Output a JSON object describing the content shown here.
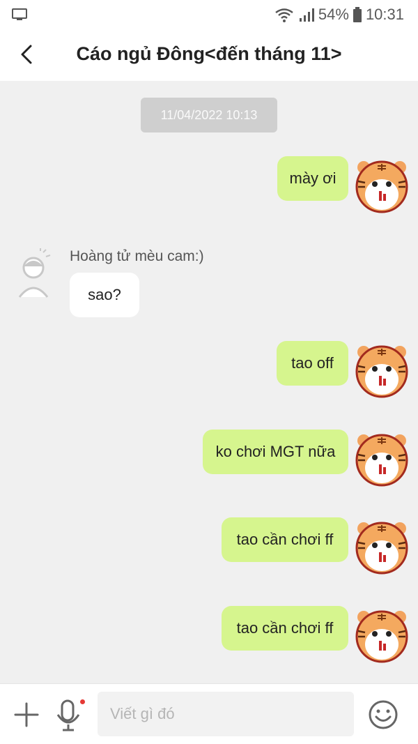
{
  "status_bar": {
    "icons": [
      "screen-icon",
      "wifi-icon",
      "signal-icon",
      "battery-icon"
    ],
    "battery": "54%",
    "time": "10:31"
  },
  "header": {
    "back_icon": "chevron-left-icon",
    "title": "Cáo ngủ Đông<đến tháng 11>"
  },
  "chat": {
    "date_stamp": "11/04/2022 10:13",
    "incoming_sender": "Hoàng tử mèu cam:)",
    "messages": [
      {
        "direction": "out",
        "text": "mày ơi"
      },
      {
        "direction": "in",
        "text": "sao?"
      },
      {
        "direction": "out",
        "text": "tao off"
      },
      {
        "direction": "out",
        "text": "ko chơi MGT nữa"
      },
      {
        "direction": "out",
        "text": "tao cần chơi ff"
      },
      {
        "direction": "out",
        "text": "tao cần chơi ff"
      }
    ]
  },
  "composer": {
    "placeholder": "Viết gì đó",
    "icons": [
      "plus-icon",
      "microphone-icon",
      "emoji-icon"
    ]
  },
  "colors": {
    "outgoing_bubble": "#d6f58e",
    "incoming_bubble": "#ffffff",
    "chat_background": "#f0f0f0",
    "date_chip": "#cfcfcf"
  }
}
